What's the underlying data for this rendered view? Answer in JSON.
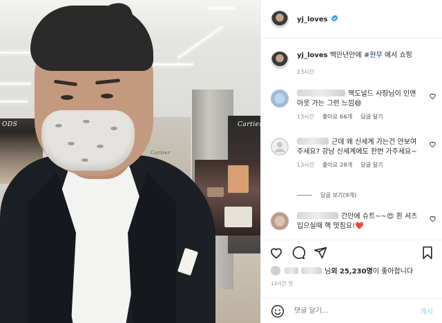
{
  "post": {
    "username": "yj_loves",
    "photo_store_signs": [
      "ODS",
      "Cartier",
      "Cartier"
    ]
  },
  "caption": {
    "username": "yj_loves",
    "text_before": "백만년만에 ",
    "hashtag": "#현무",
    "text_after": " 에서 쇼핑",
    "time": "13시간"
  },
  "comments": [
    {
      "text": "맥도널드 사장님이 인앤아웃 가는 그런 느낌😄",
      "time": "13시간",
      "likes": "좋아요 66개",
      "reply": "답글 달기"
    },
    {
      "text": "근데 왜 신세계 가는건 안보여주세요? 강남 신세계에도 한번 가주세요~",
      "time": "13시간",
      "likes": "좋아요 28개",
      "reply": "답글 달기",
      "view_replies": "답글 보기(9개)"
    },
    {
      "text": "간만에 슈트~~😍 흰 셔츠 입으실때 핵 멋짐요!❤️"
    }
  ],
  "likes_summary": {
    "prefix": "님 ",
    "bold": "외 25,230명",
    "suffix": "이 좋아합니다"
  },
  "timestamp": "13시간 전",
  "comment_box": {
    "placeholder": "댓글 달기...",
    "post_label": "게시"
  },
  "colors": {
    "verified": "#3897f0",
    "hashtag": "#00376b",
    "post_button_disabled": "#b2dffc",
    "heart_red": "#ed4956"
  },
  "icons": [
    "verified-badge-icon",
    "heart-icon",
    "comment-icon",
    "share-icon",
    "bookmark-icon",
    "emoji-icon"
  ]
}
